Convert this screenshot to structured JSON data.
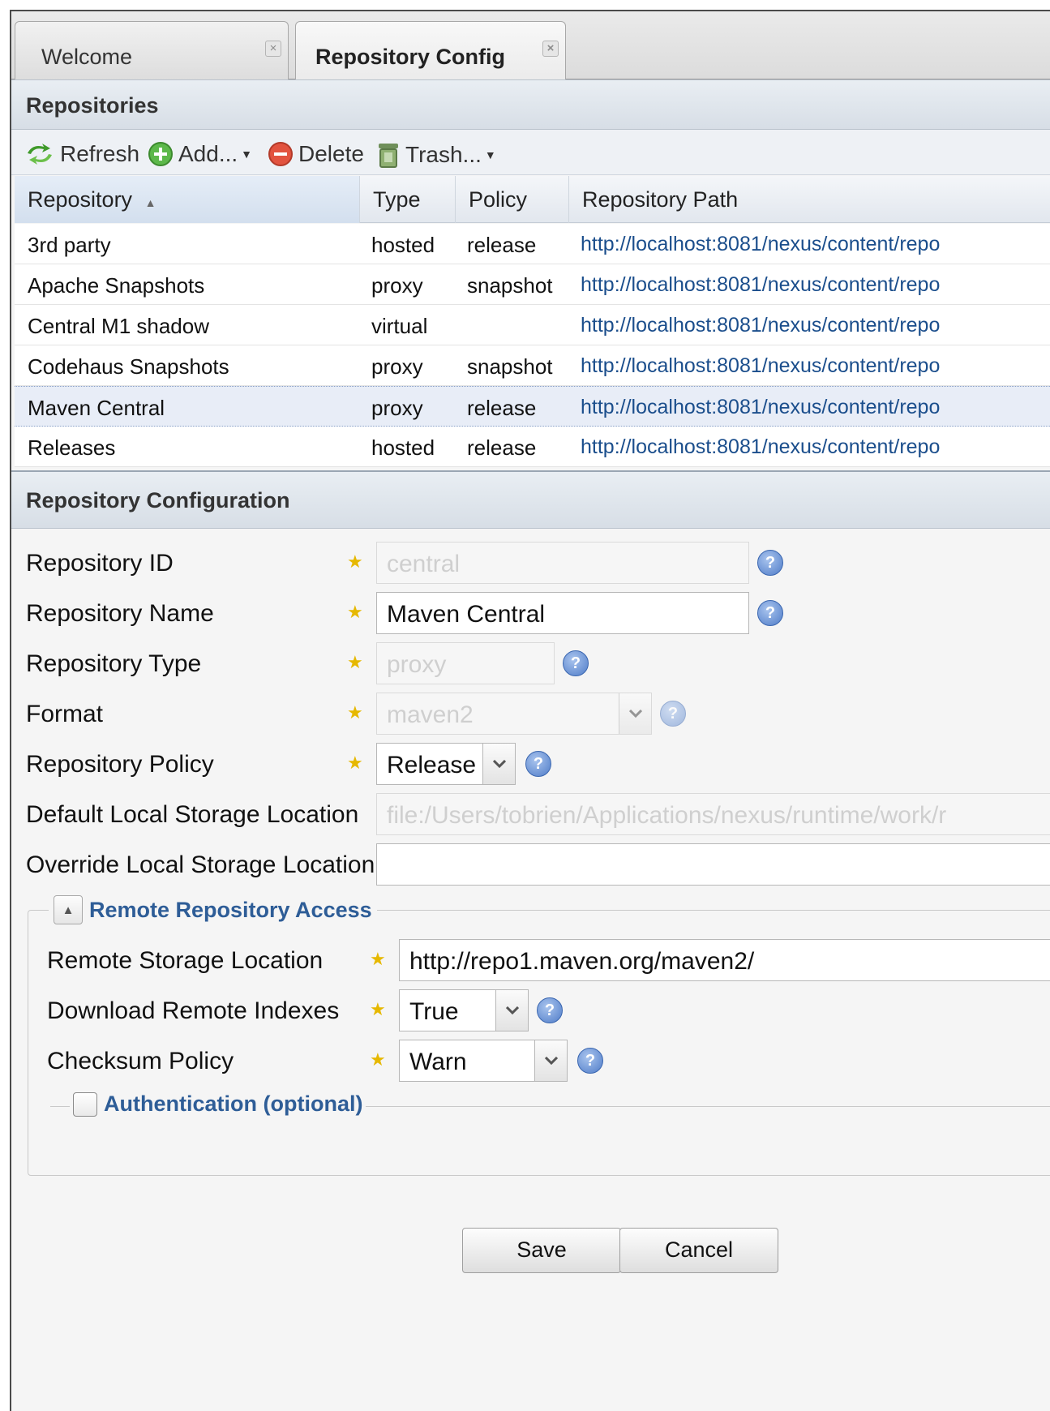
{
  "tabs": [
    {
      "label": "Welcome",
      "active": false
    },
    {
      "label": "Repository Config",
      "active": true
    }
  ],
  "repositories_panel": {
    "title": "Repositories"
  },
  "toolbar": {
    "refresh_label": "Refresh",
    "add_label": "Add...",
    "delete_label": "Delete",
    "trash_label": "Trash..."
  },
  "grid": {
    "columns": [
      "Repository",
      "Type",
      "Policy",
      "Repository Path"
    ],
    "sorted_column": "Repository",
    "rows": [
      {
        "name": "3rd party",
        "type": "hosted",
        "policy": "release",
        "path": "http://localhost:8081/nexus/content/repo",
        "selected": false
      },
      {
        "name": "Apache Snapshots",
        "type": "proxy",
        "policy": "snapshot",
        "path": "http://localhost:8081/nexus/content/repo",
        "selected": false
      },
      {
        "name": "Central M1 shadow",
        "type": "virtual",
        "policy": "",
        "path": "http://localhost:8081/nexus/content/repo",
        "selected": false
      },
      {
        "name": "Codehaus Snapshots",
        "type": "proxy",
        "policy": "snapshot",
        "path": "http://localhost:8081/nexus/content/repo",
        "selected": false
      },
      {
        "name": "Maven Central",
        "type": "proxy",
        "policy": "release",
        "path": "http://localhost:8081/nexus/content/repo",
        "selected": true
      },
      {
        "name": "Releases",
        "type": "hosted",
        "policy": "release",
        "path": "http://localhost:8081/nexus/content/repo",
        "selected": false
      }
    ]
  },
  "config_panel": {
    "title": "Repository Configuration"
  },
  "form": {
    "repo_id": {
      "label": "Repository ID",
      "value": "central"
    },
    "repo_name": {
      "label": "Repository Name",
      "value": "Maven Central"
    },
    "repo_type": {
      "label": "Repository Type",
      "value": "proxy"
    },
    "format": {
      "label": "Format",
      "value": "maven2"
    },
    "repo_policy": {
      "label": "Repository Policy",
      "value": "Release"
    },
    "default_storage": {
      "label": "Default Local Storage Location",
      "value": "file:/Users/tobrien/Applications/nexus/runtime/work/r"
    },
    "override_storage": {
      "label": "Override Local Storage Location",
      "value": ""
    },
    "remote_section": {
      "title": "Remote Repository Access"
    },
    "remote_location": {
      "label": "Remote Storage Location",
      "value": "http://repo1.maven.org/maven2/"
    },
    "download_indexes": {
      "label": "Download Remote Indexes",
      "value": "True"
    },
    "checksum_policy": {
      "label": "Checksum Policy",
      "value": "Warn"
    },
    "auth_section": {
      "title": "Authentication (optional)"
    },
    "save_label": "Save",
    "cancel_label": "Cancel"
  },
  "colors": {
    "accent": "#2e5d97",
    "link": "#1b4e8c",
    "required_star": "#e6b800",
    "selected_row": "#e8edf7"
  },
  "icons": [
    "refresh-icon",
    "add-icon",
    "delete-icon",
    "trash-icon",
    "help-icon",
    "close-icon",
    "sort-asc-icon",
    "chevron-down-icon",
    "collapse-icon"
  ]
}
